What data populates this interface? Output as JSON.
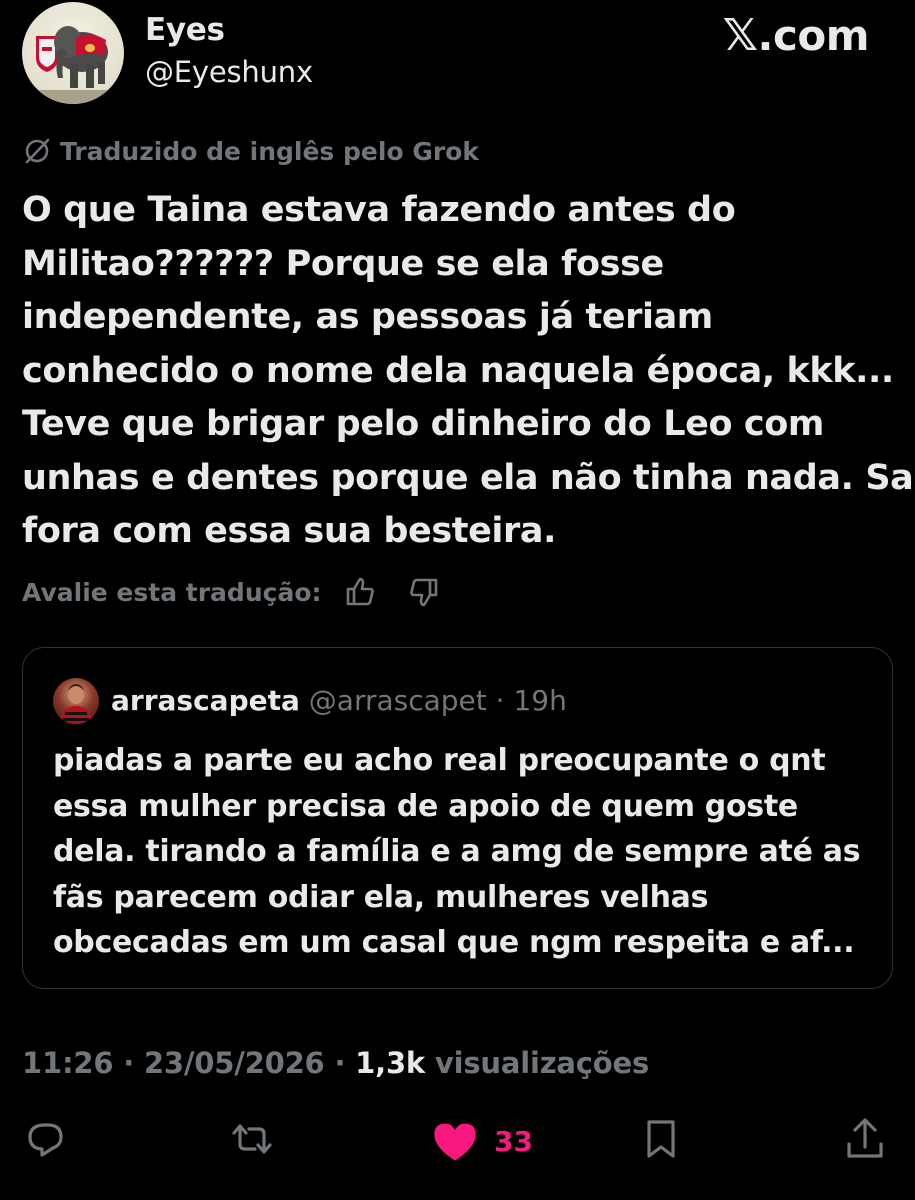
{
  "author": {
    "name": "Eyes",
    "handle": "@Eyeshunx",
    "avatar_icon": "elephant-avatar-icon"
  },
  "brand": {
    "x_glyph": "𝕏",
    "domain_suffix": ".com"
  },
  "translation_notice": "Traduzido de inglês pelo Grok",
  "tweet_lines": [
    "O que Taina estava fazendo antes do",
    "Militao?????? Porque se ela fosse",
    "independente, as pessoas já teriam",
    "conhecido o nome dela naquela época, kkk...",
    "Teve que brigar pelo dinheiro do Leo com",
    "unhas e dentes porque ela não tinha nada. Sai",
    "fora com essa sua besteira."
  ],
  "rate_translation_label": "Avalie esta tradução:",
  "quote": {
    "name": "arrascapeta",
    "handle": "@arrascapet",
    "separator": " · ",
    "age": "19h",
    "lines": [
      "piadas a parte eu acho real preocupante o qnt",
      "essa mulher precisa de apoio de quem goste",
      "dela. tirando a família e a amg de sempre até as",
      "fãs parecem odiar ela, mulheres velhas",
      "obcecadas em um casal que ngm respeita e af..."
    ]
  },
  "meta": {
    "time": "11:26",
    "date": "23/05/2026",
    "separator": " · ",
    "views_count": "1,3k",
    "views_label": " visualizações"
  },
  "actions": {
    "like_count": "33"
  },
  "colors": {
    "background": "#000000",
    "text_primary": "#e7e9ea",
    "text_secondary": "#71767b",
    "border": "#2f3336",
    "like_pink": "#f91880"
  }
}
